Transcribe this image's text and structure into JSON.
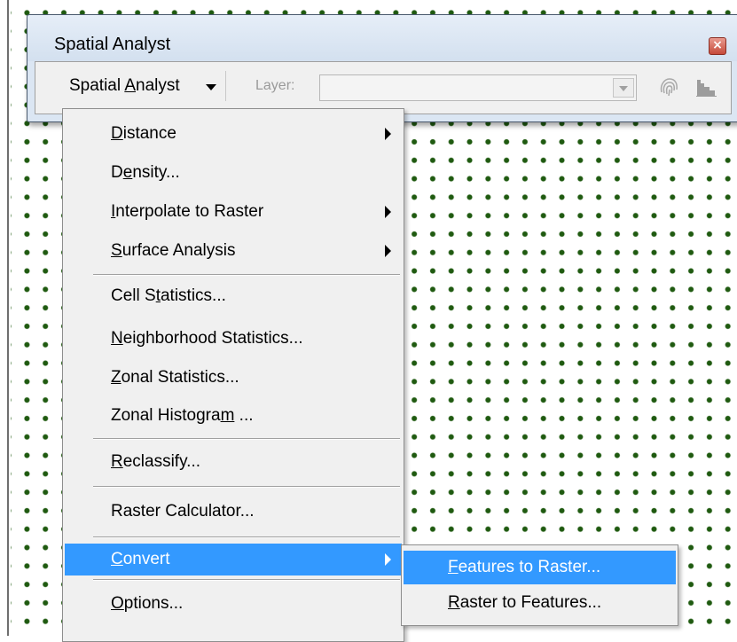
{
  "window": {
    "title": "Spatial Analyst",
    "close_glyph": "×"
  },
  "toolbar": {
    "menu_button": {
      "pre": "Spatial ",
      "ul": "A",
      "post": "nalyst"
    },
    "layer_label": "Layer:",
    "layer_value": "",
    "icons": [
      "fingerprint-icon",
      "histogram-icon"
    ]
  },
  "menu": {
    "items": [
      {
        "pre": "",
        "ul": "D",
        "post": "istance",
        "submenu": true
      },
      {
        "pre": "D",
        "ul": "e",
        "post": "nsity...",
        "submenu": false
      },
      {
        "pre": "",
        "ul": "I",
        "post": "nterpolate to Raster",
        "submenu": true
      },
      {
        "pre": "",
        "ul": "S",
        "post": "urface Analysis",
        "submenu": true
      },
      {
        "pre": "Cell S",
        "ul": "t",
        "post": "atistics...",
        "submenu": false
      },
      {
        "pre": "",
        "ul": "N",
        "post": "eighborhood Statistics...",
        "submenu": false
      },
      {
        "pre": "",
        "ul": "Z",
        "post": "onal Statistics...",
        "submenu": false
      },
      {
        "pre": "Zonal Histogra",
        "ul": "m",
        "post": " ...",
        "submenu": false
      },
      {
        "pre": "",
        "ul": "R",
        "post": "eclassify...",
        "submenu": false
      },
      {
        "pre": "Raster Calculator...",
        "ul": "",
        "post": "",
        "submenu": false
      },
      {
        "pre": "",
        "ul": "C",
        "post": "onvert",
        "submenu": true,
        "highlighted": true
      },
      {
        "pre": "",
        "ul": "O",
        "post": "ptions...",
        "submenu": false
      }
    ]
  },
  "submenu": {
    "items": [
      {
        "pre": "",
        "ul": "F",
        "post": "eatures to Raster...",
        "highlighted": true
      },
      {
        "pre": "",
        "ul": "R",
        "post": "aster to Features...",
        "highlighted": false
      }
    ]
  },
  "colors": {
    "highlight": "#3399ff",
    "dots": "#1f5a10",
    "menu_bg": "#f0f0f0",
    "window_bg": "#dbe6f3"
  }
}
